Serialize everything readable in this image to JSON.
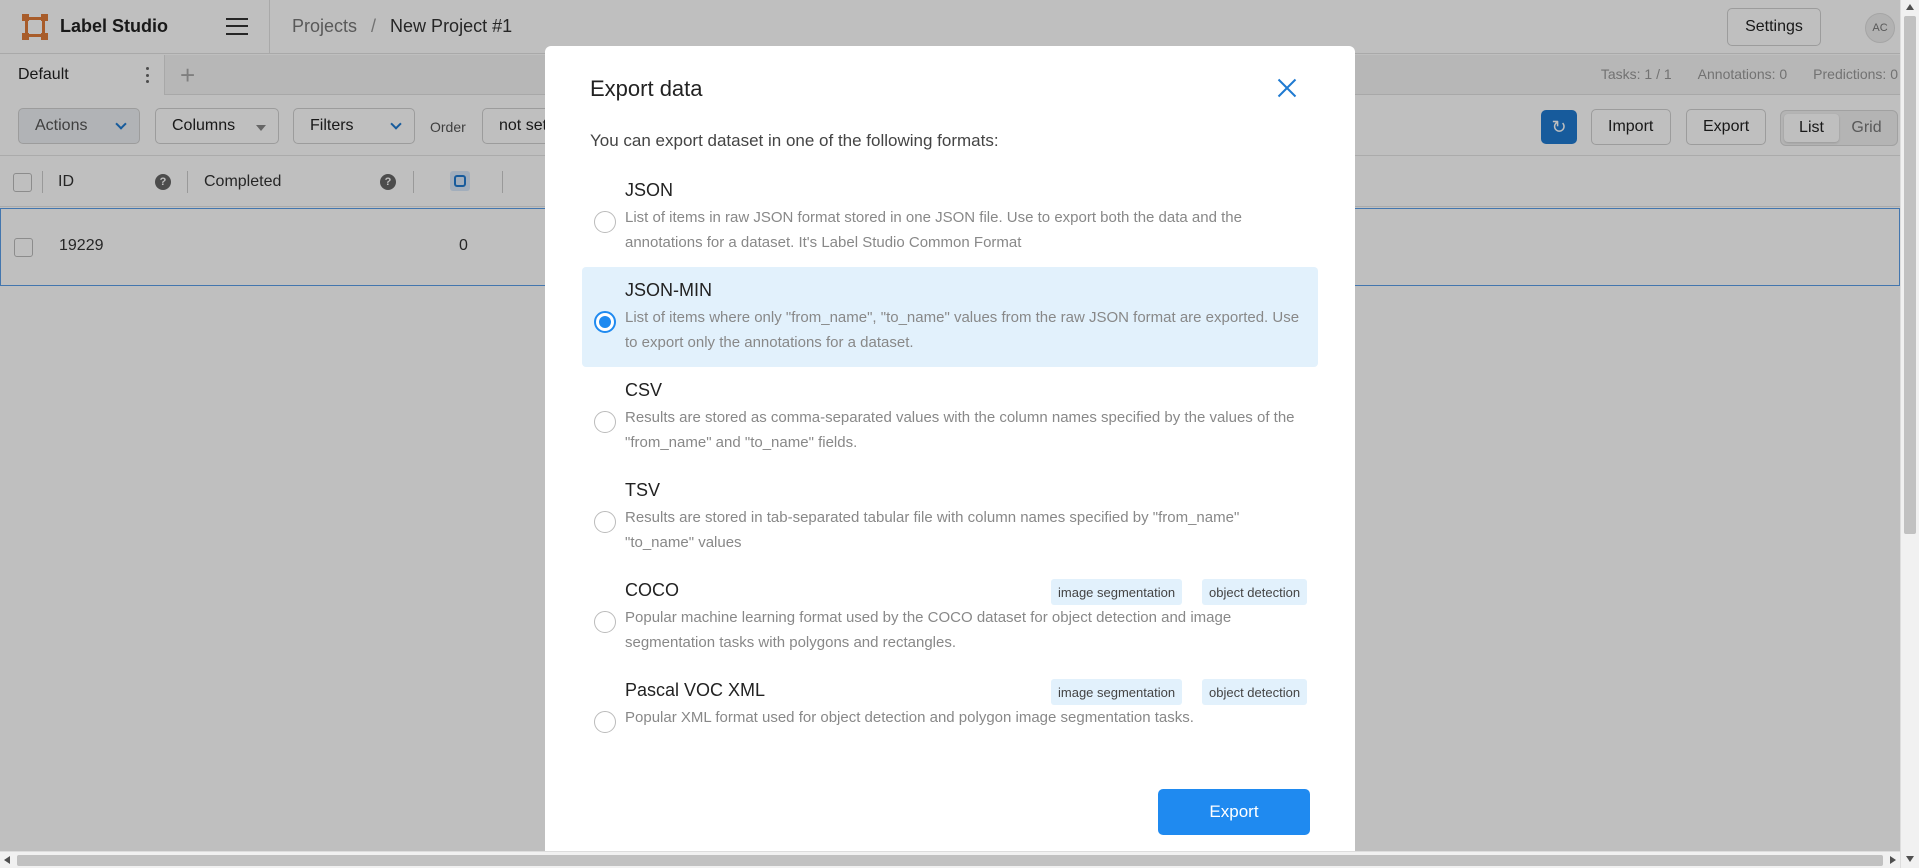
{
  "header": {
    "app_name": "Label Studio",
    "breadcrumb": [
      "Projects",
      "/",
      "New Project #1"
    ],
    "settings_label": "Settings",
    "avatar_initials": "AC"
  },
  "tabs": {
    "items": [
      {
        "label": "Default"
      }
    ],
    "stats": [
      "Tasks: 1 / 1",
      "Annotations: 0",
      "Predictions: 0"
    ]
  },
  "toolbar": {
    "actions_label": "Actions",
    "columns_label": "Columns",
    "filters_label": "Filters",
    "order_label": "Order",
    "order_value": "not set",
    "import_label": "Import",
    "export_label": "Export",
    "view_modes": [
      "List",
      "Grid"
    ],
    "active_view": "List"
  },
  "table": {
    "columns": [
      "ID",
      "Completed"
    ],
    "rows": [
      {
        "id": "19229",
        "completed": "",
        "count": "0"
      }
    ]
  },
  "modal": {
    "title": "Export data",
    "description": "You can export dataset in one of the following formats:",
    "formats": [
      {
        "title": "JSON",
        "description": "List of items in raw JSON format stored in one JSON file. Use to export both the data and the annotations for a dataset. It's Label Studio Common Format",
        "selected": false,
        "tags": []
      },
      {
        "title": "JSON-MIN",
        "description": "List of items where only \"from_name\", \"to_name\" values from the raw JSON format are exported. Use to export only the annotations for a dataset.",
        "selected": true,
        "tags": []
      },
      {
        "title": "CSV",
        "description": "Results are stored as comma-separated values with the column names specified by the values of the \"from_name\" and \"to_name\" fields.",
        "selected": false,
        "tags": []
      },
      {
        "title": "TSV",
        "description": "Results are stored in tab-separated tabular file with column names specified by \"from_name\" \"to_name\" values",
        "selected": false,
        "tags": []
      },
      {
        "title": "COCO",
        "description": "Popular machine learning format used by the COCO dataset for object detection and image segmentation tasks with polygons and rectangles.",
        "selected": false,
        "tags": [
          "image segmentation",
          "object detection"
        ]
      },
      {
        "title": "Pascal VOC XML",
        "description": "Popular XML format used for object detection and polygon image segmentation tasks.",
        "selected": false,
        "tags": [
          "image segmentation",
          "object detection"
        ]
      }
    ],
    "export_button": "Export"
  },
  "colors": {
    "accent": "#1f8af0",
    "brand": "#e07b39",
    "selected_bg": "#e2f1fc"
  },
  "icons": [
    "label-studio-logo-icon",
    "hamburger-menu-icon",
    "close-icon",
    "refresh-icon",
    "help-icon",
    "chevron-down-icon",
    "plus-icon",
    "more-vertical-icon"
  ]
}
